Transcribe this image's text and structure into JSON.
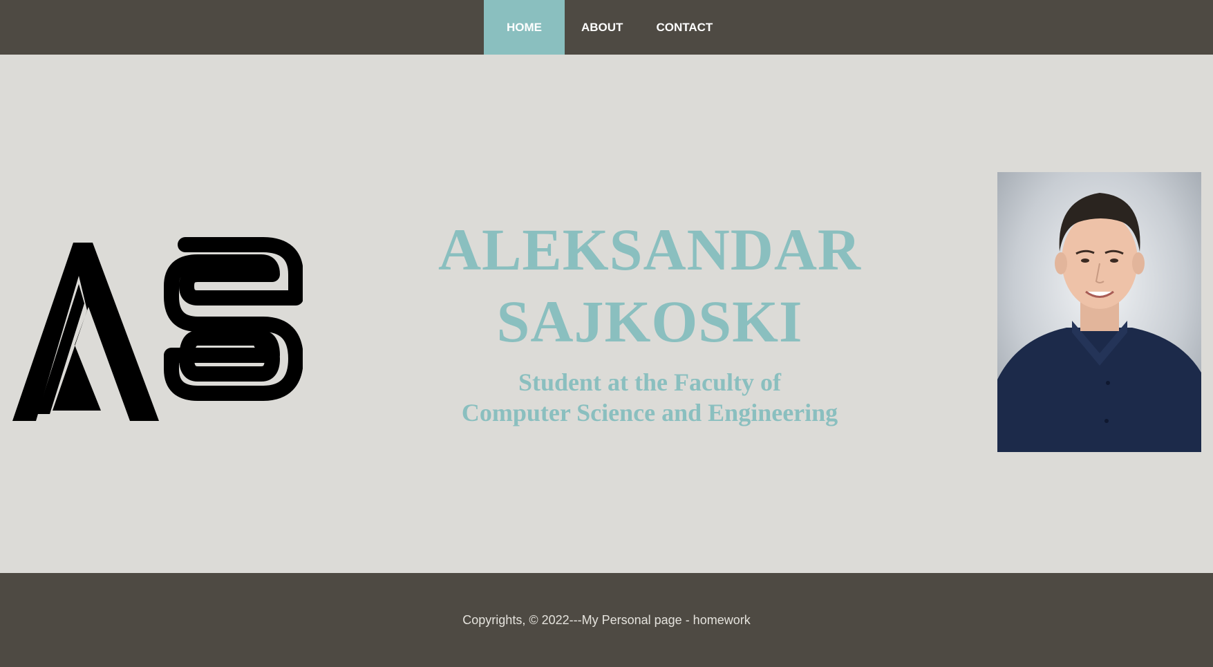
{
  "nav": {
    "items": [
      {
        "label": "HOME",
        "active": true
      },
      {
        "label": "ABOUT",
        "active": false
      },
      {
        "label": "CONTACT",
        "active": false
      }
    ]
  },
  "hero": {
    "logo_text": "AS",
    "name_first": "ALEKSANDAR",
    "name_last": "SAJKOSKI",
    "subtitle_line1": "Student at the Faculty of",
    "subtitle_line2": "Computer Science and Engineering",
    "photo_icon": "portrait-photo"
  },
  "footer": {
    "text": "Copyrights, © 2022---My Personal page - homework"
  },
  "colors": {
    "nav_bg": "#4e4a43",
    "accent": "#8abfbf",
    "page_bg": "#dcdbd7",
    "logo": "#000000"
  }
}
